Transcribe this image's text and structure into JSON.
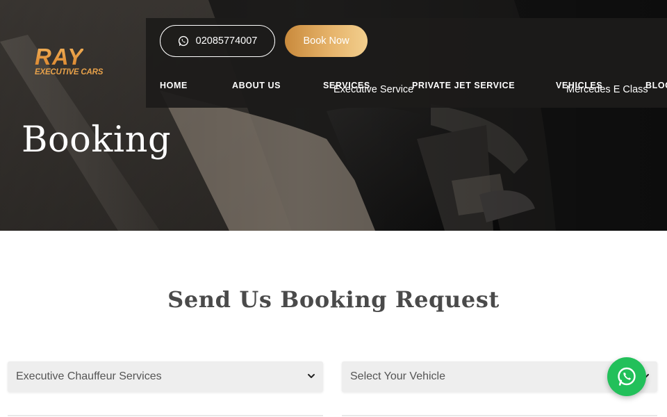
{
  "brand": {
    "name": "RAY",
    "tagline": "EXECUTIVE CARS",
    "accent": "#e39a3b"
  },
  "header": {
    "phone": "02085774007",
    "phone_icon": "whatsapp-icon",
    "book_label": "Book Now"
  },
  "nav": {
    "items": [
      {
        "label": "HOME"
      },
      {
        "label": "ABOUT US"
      },
      {
        "label": "SERVICES"
      },
      {
        "label": "PRIVATE JET SERVICE"
      },
      {
        "label": "VEHICLES"
      },
      {
        "label": "BLOG"
      }
    ],
    "submenus": {
      "services": "Executive Service",
      "vehicles": "Mercedes E Class"
    }
  },
  "hero": {
    "title": "Booking"
  },
  "form": {
    "heading": "Send Us Booking Request",
    "service_select": {
      "value": "Executive Chauffeur Services",
      "icon": "chevron-down-icon"
    },
    "vehicle_select": {
      "value": "Select Your Vehicle",
      "icon": "chevron-down-icon"
    }
  },
  "whatsapp_fab": {
    "icon": "whatsapp-icon",
    "color": "#22c05a"
  }
}
